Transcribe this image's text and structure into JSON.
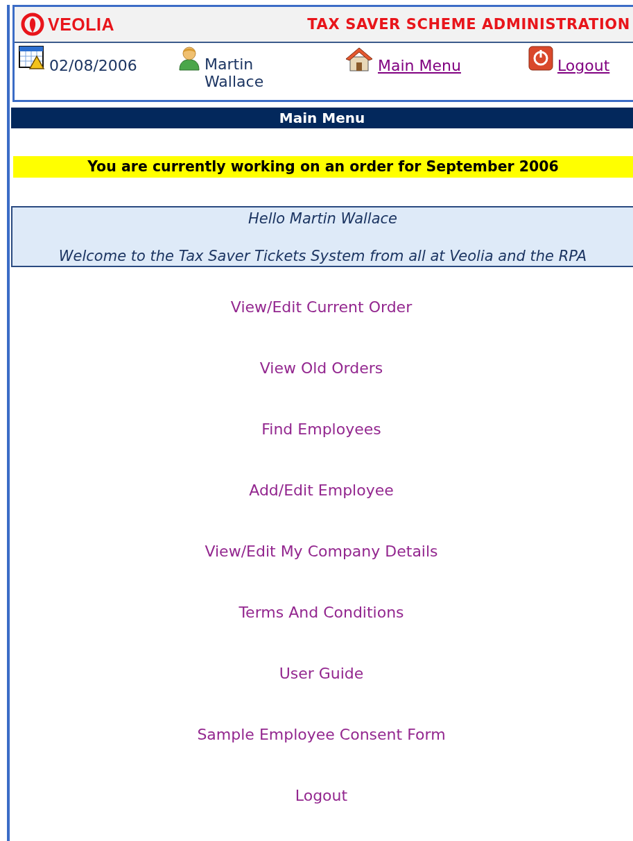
{
  "header": {
    "logo": "VEOLIA",
    "title": "TAX SAVER SCHEME ADMINISTRATION",
    "date": "02/08/2006",
    "user": "Martin Wallace",
    "links": [
      {
        "label": "Main Menu",
        "kind": "home"
      },
      {
        "label": "Logout",
        "kind": "logout"
      }
    ]
  },
  "nav_bar": {
    "title": "Main Menu"
  },
  "notice": "You are currently working on an order for September 2006",
  "welcome": {
    "greeting": "Hello Martin Wallace",
    "message": "Welcome to the Tax Saver Tickets System from all at Veolia and the RPA"
  },
  "menu": [
    "View/Edit Current Order",
    "View Old Orders",
    "Find Employees",
    "Add/Edit Employee",
    "View/Edit My Company Details",
    "Terms And Conditions",
    "User Guide",
    "Sample Employee Consent Form",
    "Logout"
  ]
}
